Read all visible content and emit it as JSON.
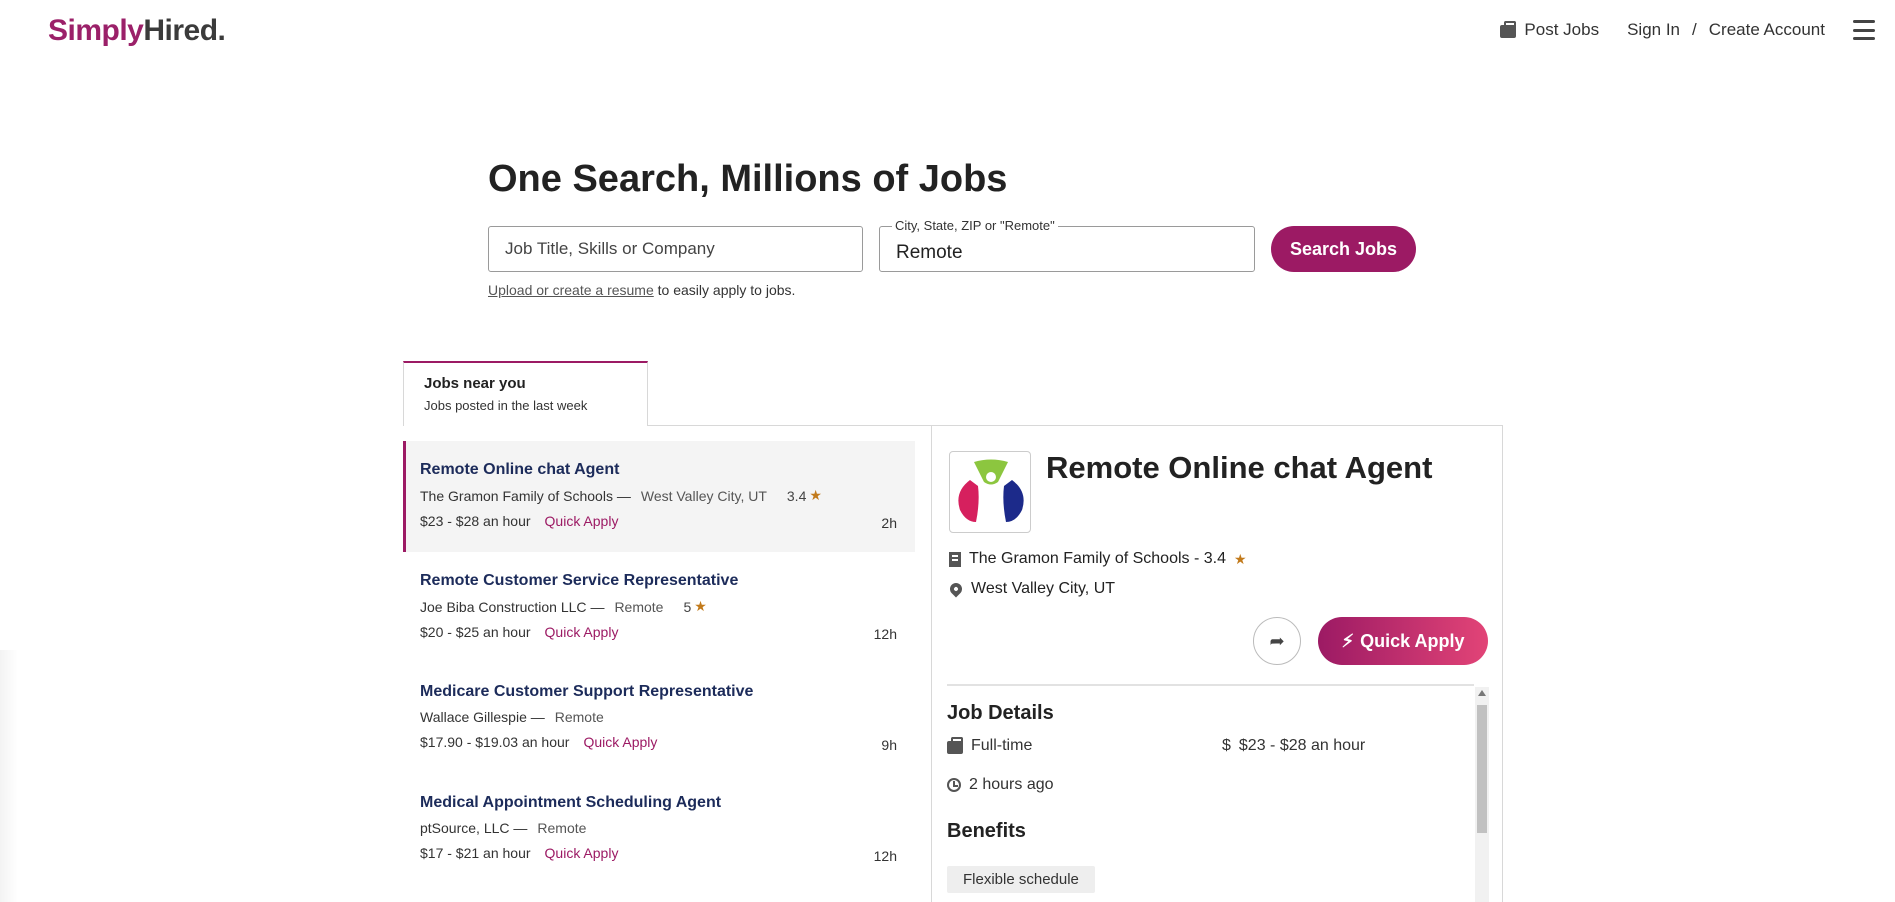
{
  "header": {
    "logo_part1": "Simply",
    "logo_part2": "Hired.",
    "post_jobs": "Post Jobs",
    "sign_in": "Sign In",
    "separator": "/",
    "create_account": "Create Account"
  },
  "hero": {
    "title": "One Search, Millions of Jobs",
    "query_placeholder": "Job Title, Skills or Company",
    "location_label": "City, State, ZIP or \"Remote\"",
    "location_value": "Remote",
    "search_button": "Search Jobs",
    "resume_link": "Upload or create a resume",
    "resume_text": " to easily apply to jobs."
  },
  "tab": {
    "title": "Jobs near you",
    "subtitle": "Jobs posted in the last week"
  },
  "jobs": [
    {
      "title": "Remote Online chat Agent",
      "company": "The Gramon Family of Schools",
      "location": "West Valley City, UT",
      "rating": "3.4",
      "pay": "$23 - $28 an hour",
      "quick_apply": "Quick Apply",
      "age": "2h"
    },
    {
      "title": "Remote Customer Service Representative",
      "company": "Joe Biba Construction LLC",
      "location": "Remote",
      "rating": "5",
      "pay": "$20 - $25 an hour",
      "quick_apply": "Quick Apply",
      "age": "12h"
    },
    {
      "title": "Medicare Customer Support Representative",
      "company": "Wallace Gillespie",
      "location": "Remote",
      "pay": "$17.90 - $19.03 an hour",
      "quick_apply": "Quick Apply",
      "age": "9h"
    },
    {
      "title": "Medical Appointment Scheduling Agent",
      "company": "ptSource, LLC",
      "location": "Remote",
      "pay": "$17 - $21 an hour",
      "quick_apply": "Quick Apply",
      "age": "12h"
    }
  ],
  "job_separator": "—",
  "detail": {
    "title": "Remote Online chat Agent",
    "company_line": "The Gramon Family of Schools - 3.4",
    "location": "West Valley City, UT",
    "quick_apply": "Quick Apply",
    "job_details_heading": "Job Details",
    "job_type": "Full-time",
    "pay_symbol": "$",
    "pay": "$23 - $28 an hour",
    "posted": "2 hours ago",
    "benefits_heading": "Benefits",
    "benefit_1": "Flexible schedule"
  },
  "colors": {
    "brand": "#9c1a64",
    "title_navy": "#1c2b5a",
    "star": "#c27a1b"
  }
}
